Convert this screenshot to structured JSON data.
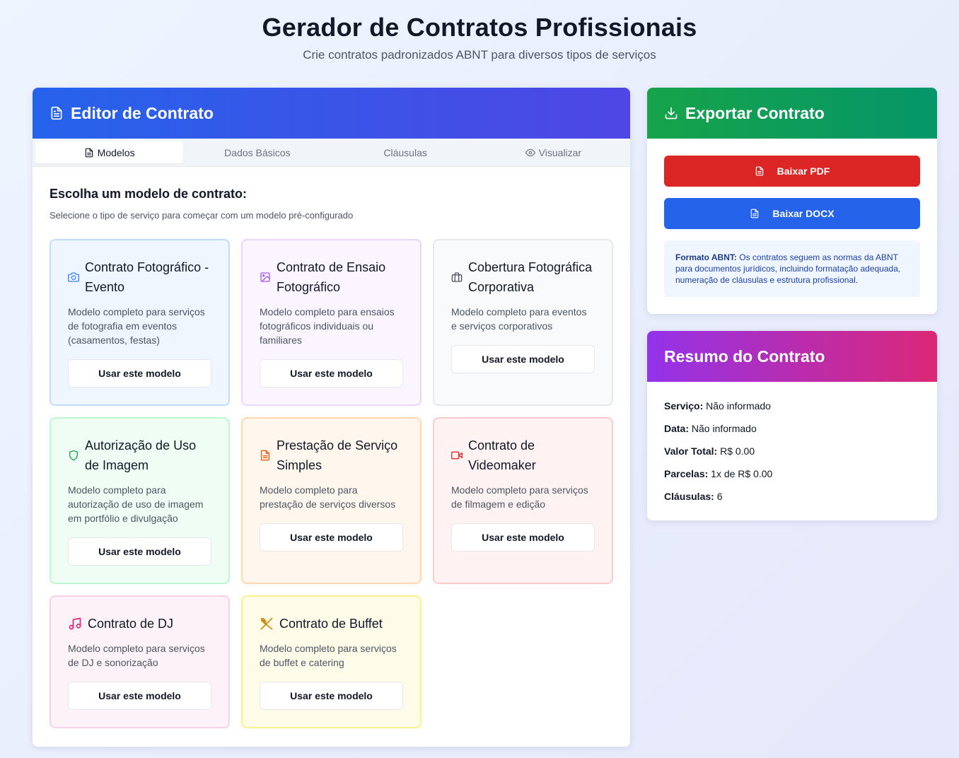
{
  "header": {
    "title": "Gerador de Contratos Profissionais",
    "subtitle": "Crie contratos padronizados ABNT para diversos tipos de serviços"
  },
  "editor": {
    "title": "Editor de Contrato",
    "tabs": [
      {
        "label": "Modelos",
        "icon": "file-text-icon",
        "active": true
      },
      {
        "label": "Dados Básicos",
        "active": false
      },
      {
        "label": "Cláusulas",
        "active": false
      },
      {
        "label": "Visualizar",
        "icon": "eye-icon",
        "active": false
      }
    ],
    "section_title": "Escolha um modelo de contrato:",
    "section_desc": "Selecione o tipo de serviço para começar com um modelo pré-configurado",
    "templates": [
      {
        "title": "Contrato Fotográfico - Evento",
        "desc": "Modelo completo para serviços de fotografia em eventos (casamentos, festas)",
        "button": "Usar este modelo",
        "icon": "camera-icon",
        "color": "#3b82f6"
      },
      {
        "title": "Contrato de Ensaio Fotográfico",
        "desc": "Modelo completo para ensaios fotográficos individuais ou familiares",
        "button": "Usar este modelo",
        "icon": "image-icon",
        "color": "#a855f7"
      },
      {
        "title": "Cobertura Fotográfica Corporativa",
        "desc": "Modelo completo para eventos e serviços corporativos",
        "button": "Usar este modelo",
        "icon": "briefcase-icon",
        "color": "#4b5563"
      },
      {
        "title": "Autorização de Uso de Imagem",
        "desc": "Modelo completo para autorização de uso de imagem em portfólio e divulgação",
        "button": "Usar este modelo",
        "icon": "shield-icon",
        "color": "#16a34a"
      },
      {
        "title": "Prestação de Serviço Simples",
        "desc": "Modelo completo para prestação de serviços diversos",
        "button": "Usar este modelo",
        "icon": "file-text-icon",
        "color": "#ea580c"
      },
      {
        "title": "Contrato de Videomaker",
        "desc": "Modelo completo para serviços de filmagem e edição",
        "button": "Usar este modelo",
        "icon": "video-icon",
        "color": "#dc2626"
      },
      {
        "title": "Contrato de DJ",
        "desc": "Modelo completo para serviços de DJ e sonorização",
        "button": "Usar este modelo",
        "icon": "music-icon",
        "color": "#db2777"
      },
      {
        "title": "Contrato de Buffet",
        "desc": "Modelo completo para serviços de buffet e catering",
        "button": "Usar este modelo",
        "icon": "utensils-icon",
        "color": "#ca8a04"
      }
    ]
  },
  "export": {
    "title": "Exportar Contrato",
    "pdf_label": "Baixar PDF",
    "docx_label": "Baixar DOCX",
    "note_label": "Formato ABNT:",
    "note_text": "Os contratos seguem as normas da ABNT para documentos jurídicos, incluindo formatação adequada, numeração de cláusulas e estrutura profissional."
  },
  "summary": {
    "title": "Resumo do Contrato",
    "rows": [
      {
        "label": "Serviço:",
        "value": "Não informado"
      },
      {
        "label": "Data:",
        "value": "Não informado"
      },
      {
        "label": "Valor Total:",
        "value": "R$ 0.00"
      },
      {
        "label": "Parcelas:",
        "value": "1x de R$ 0.00"
      },
      {
        "label": "Cláusulas:",
        "value": "6"
      }
    ]
  }
}
